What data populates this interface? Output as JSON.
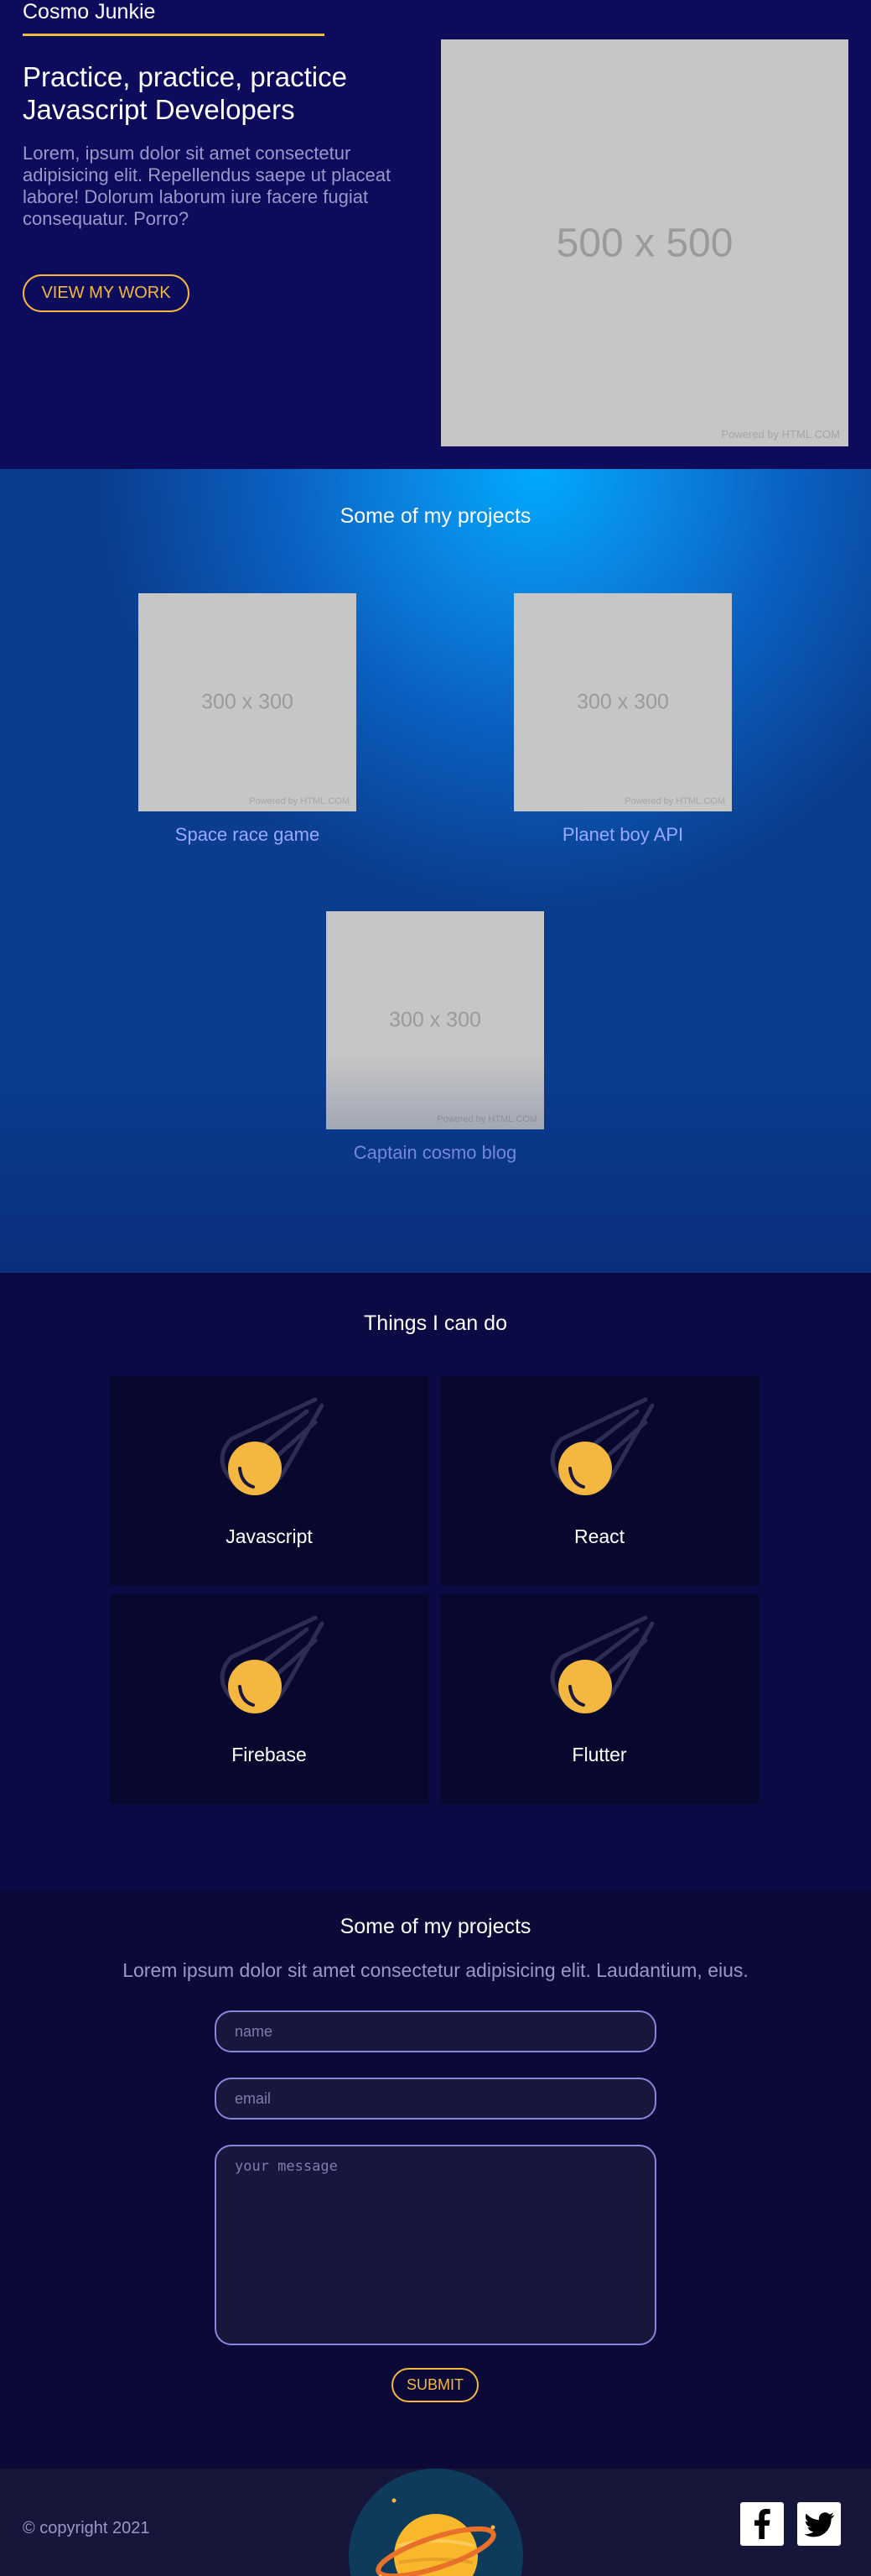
{
  "header": {
    "brand": "Cosmo Junkie",
    "title": "Practice, practice, practice Javascript Developers",
    "text": "Lorem, ipsum dolor sit amet consectetur adipisicing elit. Repellendus saepe ut placeat labore! Dolorum laborum iure facere fugiat consequatur. Porro?",
    "cta_label": "VIEW MY WORK",
    "image": {
      "label": "500 x 500",
      "credit": "Powered by HTML.COM"
    }
  },
  "projects": {
    "title": "Some of my projects",
    "items": [
      {
        "name": "Space race game",
        "image_label": "300 x 300",
        "credit": "Powered by HTML.COM"
      },
      {
        "name": "Planet boy API",
        "image_label": "300 x 300",
        "credit": "Powered by HTML.COM"
      },
      {
        "name": "Captain cosmo blog",
        "image_label": "300 x 300",
        "credit": "Powered by HTML.COM"
      }
    ]
  },
  "skills": {
    "title": "Things I can do",
    "items": [
      {
        "name": "Javascript",
        "icon": "meteor-icon"
      },
      {
        "name": "React",
        "icon": "meteor-icon"
      },
      {
        "name": "Firebase",
        "icon": "meteor-icon"
      },
      {
        "name": "Flutter",
        "icon": "meteor-icon"
      }
    ]
  },
  "contact": {
    "title": "Some of my projects",
    "subtitle": "Lorem ipsum dolor sit amet consectetur adipisicing elit. Laudantium, eius.",
    "name_placeholder": "name",
    "email_placeholder": "email",
    "message_placeholder": "your message",
    "submit_label": "SUBMIT"
  },
  "footer": {
    "copyright": "© copyright 2021",
    "logo_icon": "saturn-icon",
    "social": [
      {
        "name": "facebook",
        "icon": "facebook-icon"
      },
      {
        "name": "twitter",
        "icon": "twitter-icon"
      }
    ]
  },
  "colors": {
    "accent": "#f4b740",
    "hero_bg": "#0c0b5c",
    "projects_bg": "#0a84e0",
    "skills_bg": "#0b0a45",
    "card_bg": "#08072e",
    "link": "#9aa8ff",
    "muted_text": "#9b98c9",
    "footer_bg": "#16153a"
  }
}
